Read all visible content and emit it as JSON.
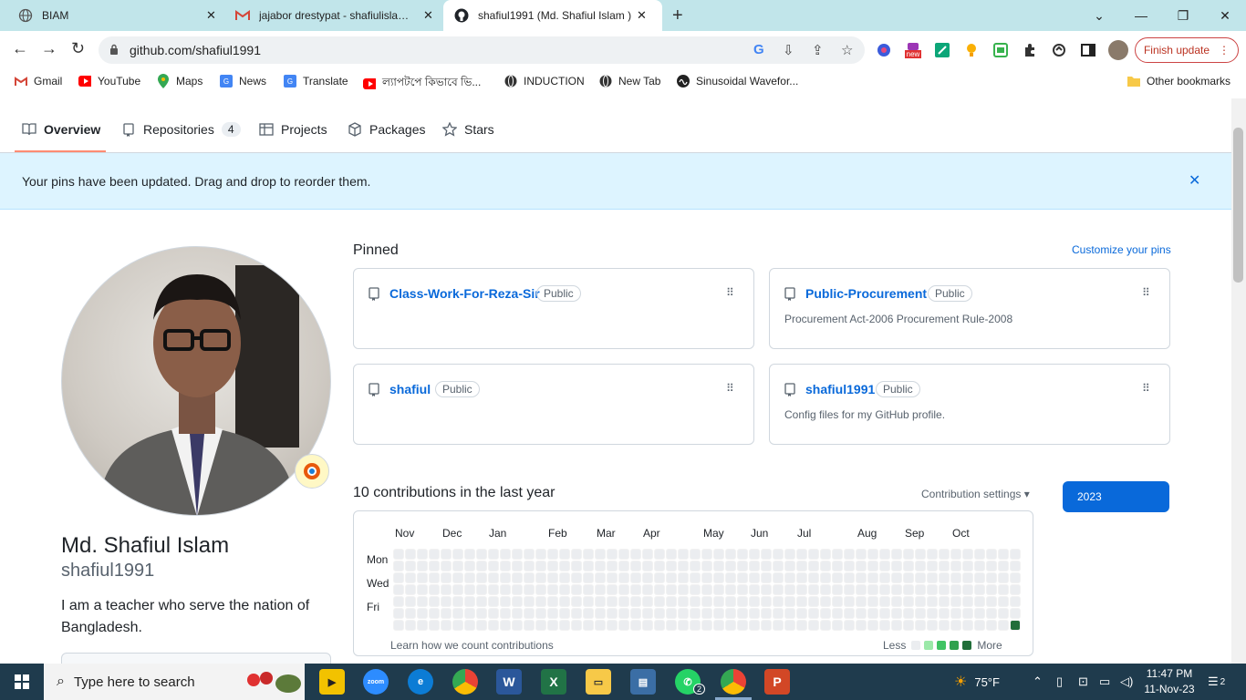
{
  "browser": {
    "tabs": [
      {
        "title": "BIAM",
        "icon": "globe-icon"
      },
      {
        "title": "jajabor drestypat - shafiulislam.m",
        "icon": "gmail-icon"
      },
      {
        "title": "shafiul1991 (Md. Shafiul Islam )",
        "icon": "github-icon",
        "active": true
      }
    ],
    "url": "github.com/shafiul1991",
    "finish_update": "Finish update",
    "ext_new_badge": "new",
    "bookmarks": [
      {
        "label": "Gmail",
        "icon": "gmail-icon"
      },
      {
        "label": "YouTube",
        "icon": "youtube-icon"
      },
      {
        "label": "Maps",
        "icon": "maps-icon"
      },
      {
        "label": "News",
        "icon": "news-icon"
      },
      {
        "label": "Translate",
        "icon": "translate-icon"
      },
      {
        "label": "ল্যাপটপে কিভাবে ভি...",
        "icon": "youtube-icon"
      },
      {
        "label": "INDUCTION",
        "icon": "globe-icon"
      },
      {
        "label": "New Tab",
        "icon": "globe-icon"
      },
      {
        "label": "Sinusoidal Wavefor...",
        "icon": "wave-icon"
      }
    ],
    "other_bookmarks": "Other bookmarks"
  },
  "github": {
    "nav": {
      "overview": "Overview",
      "repositories": "Repositories",
      "repo_count": "4",
      "projects": "Projects",
      "packages": "Packages",
      "stars": "Stars"
    },
    "flash": "Your pins have been updated. Drag and drop to reorder them.",
    "profile": {
      "name": "Md. Shafiul Islam",
      "login": "shafiul1991",
      "bio": "I am a teacher who serve the nation of Bangladesh."
    },
    "pinned_label": "Pinned",
    "customize": "Customize your pins",
    "pinned": [
      {
        "name": "Class-Work-For-Reza-Sir",
        "visibility": "Public",
        "description": ""
      },
      {
        "name": "Public-Procurement",
        "visibility": "Public",
        "description": "Procurement Act-2006 Procurement Rule-2008"
      },
      {
        "name": "shafiul",
        "visibility": "Public",
        "description": ""
      },
      {
        "name": "shafiul1991",
        "visibility": "Public",
        "description": "Config files for my GitHub profile."
      }
    ],
    "contrib": {
      "heading": "10 contributions in the last year",
      "settings": "Contribution settings ▾",
      "year": "2023",
      "months": [
        "Nov",
        "Dec",
        "Jan",
        "Feb",
        "Mar",
        "Apr",
        "May",
        "Jun",
        "Jul",
        "Aug",
        "Sep",
        "Oct"
      ],
      "weekdays": [
        "Mon",
        "Wed",
        "Fri"
      ],
      "weeks": 53,
      "active_cell": {
        "week": 52,
        "day": 6,
        "level": 4
      },
      "learn": "Learn how we count contributions",
      "less": "Less",
      "more": "More",
      "colors": [
        "#ebedf0",
        "#9be9a8",
        "#40c463",
        "#30a14e",
        "#216e39"
      ]
    }
  },
  "taskbar": {
    "search_placeholder": "Type here to search",
    "weather": "75°F",
    "time": "11:47 PM",
    "date": "11-Nov-23",
    "notifications": "2",
    "whatsapp_badge": "2"
  }
}
